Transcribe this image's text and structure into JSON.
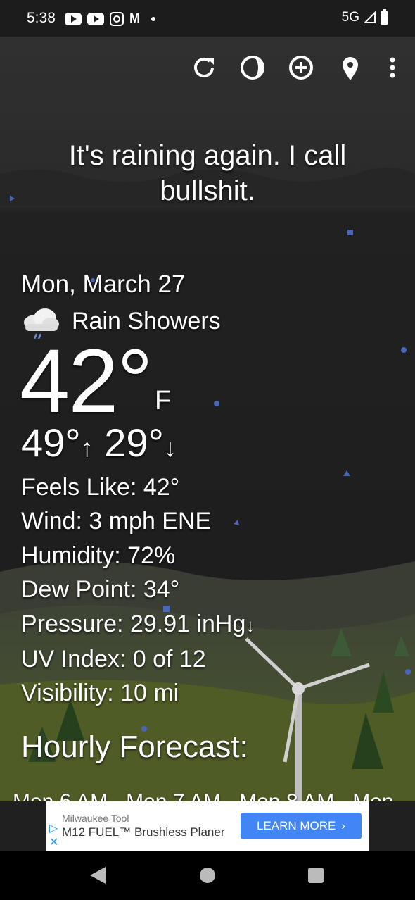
{
  "status_bar": {
    "time": "5:38",
    "network": "5G"
  },
  "toolbar": {
    "icons": [
      "refresh-icon",
      "theme-icon",
      "add-location-icon",
      "location-pin-icon",
      "more-options-icon"
    ]
  },
  "headline": "It's raining again. I call bullshit.",
  "current": {
    "date": "Mon, March 27",
    "condition": "Rain Showers",
    "temperature": "42°",
    "unit": "F",
    "high": "49°",
    "low": "29°"
  },
  "details": {
    "feels_like": "Feels Like:  42°",
    "wind": "Wind:  3 mph ENE",
    "humidity": "Humidity:  72%",
    "dew_point": "Dew Point:  34°",
    "pressure": "Pressure:  29.91 inHg",
    "uv_index": "UV Index:  0 of 12",
    "visibility": "Visibility:  10 mi"
  },
  "hourly": {
    "title": "Hourly Forecast:",
    "items": [
      "Mon 6 AM",
      "Mon 7 AM",
      "Mon 8 AM",
      "Mon"
    ]
  },
  "ad": {
    "advertiser": "Milwaukee Tool",
    "title": "M12 FUEL™ Brushless Planer",
    "cta": "LEARN MORE"
  }
}
